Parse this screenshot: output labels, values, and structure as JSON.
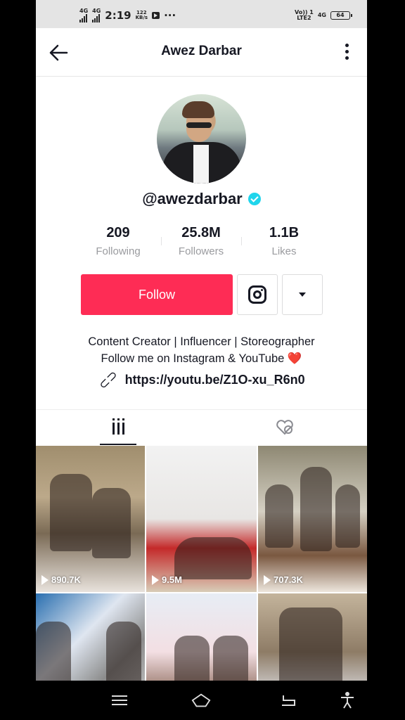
{
  "status_bar": {
    "network_left_1": "4G",
    "network_left_2": "4G",
    "time": "2:19",
    "speed_value": "122",
    "speed_unit": "KB/s",
    "dots": "···",
    "volte": "Vo)) 1",
    "lte": "LTE2",
    "network_right": "4G",
    "battery": "64"
  },
  "header": {
    "title": "Awez Darbar"
  },
  "profile": {
    "username": "@awezdarbar",
    "stats": [
      {
        "value": "209",
        "label": "Following"
      },
      {
        "value": "25.8M",
        "label": "Followers"
      },
      {
        "value": "1.1B",
        "label": "Likes"
      }
    ],
    "follow_label": "Follow",
    "bio_line1": "Content Creator | Influencer | Storeographer",
    "bio_line2": "Follow me on Instagram & YouTube",
    "heart": "❤️",
    "link": "https://youtu.be/Z1O-xu_R6n0"
  },
  "videos": [
    {
      "views": "890.7K"
    },
    {
      "views": "9.5M"
    },
    {
      "views": "707.3K"
    },
    {
      "views": ""
    },
    {
      "views": ""
    },
    {
      "views": ""
    }
  ],
  "colors": {
    "accent": "#fe2c55",
    "verified": "#20d5ec",
    "text": "#161823",
    "muted": "#9a9b9f"
  },
  "icons": [
    "back-arrow-icon",
    "more-vertical-icon",
    "verified-icon",
    "instagram-icon",
    "caret-down-icon",
    "link-icon",
    "grid-icon",
    "liked-videos-icon",
    "play-icon",
    "menu-icon",
    "home-icon",
    "back-icon",
    "accessibility-icon"
  ]
}
